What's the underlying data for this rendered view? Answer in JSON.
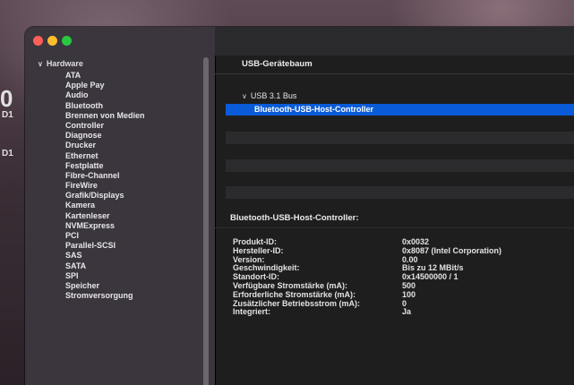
{
  "background": {
    "fragments": [
      "0",
      "D1",
      "D1"
    ]
  },
  "sidebar": {
    "root_label": "Hardware",
    "items": [
      "ATA",
      "Apple Pay",
      "Audio",
      "Bluetooth",
      "Brennen von Medien",
      "Controller",
      "Diagnose",
      "Drucker",
      "Ethernet",
      "Festplatte",
      "Fibre-Channel",
      "FireWire",
      "Grafik/Displays",
      "Kamera",
      "Kartenleser",
      "NVMExpress",
      "PCI",
      "Parallel-SCSI",
      "SAS",
      "SATA",
      "SPI",
      "Speicher",
      "Stromversorgung"
    ]
  },
  "main": {
    "section_title": "USB-Gerätebaum",
    "tree": {
      "bus": "USB 3.1 Bus",
      "selected_device": "Bluetooth-USB-Host-Controller"
    },
    "detail": {
      "title": "Bluetooth-USB-Host-Controller:",
      "properties": [
        {
          "label": "Produkt-ID:",
          "value": "0x0032"
        },
        {
          "label": "Hersteller-ID:",
          "value": "0x8087  (Intel Corporation)"
        },
        {
          "label": "Version:",
          "value": "0.00"
        },
        {
          "label": "Geschwindigkeit:",
          "value": "Bis zu 12 MBit/s"
        },
        {
          "label": "Standort-ID:",
          "value": "0x14500000 / 1"
        },
        {
          "label": "Verfügbare Stromstärke (mA):",
          "value": "500"
        },
        {
          "label": "Erforderliche Stromstärke (mA):",
          "value": "100"
        },
        {
          "label": "Zusätzlicher Betriebsstrom (mA):",
          "value": "0"
        },
        {
          "label": "Integriert:",
          "value": "Ja"
        }
      ]
    }
  },
  "colors": {
    "selection": "#0a5bd8",
    "close": "#ff5f57",
    "minimize": "#febc2e",
    "zoom": "#28c840"
  }
}
